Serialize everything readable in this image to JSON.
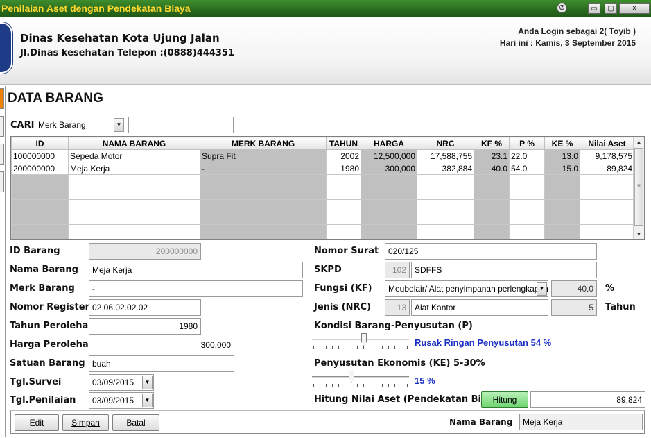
{
  "window": {
    "title": "Penilaian Aset dengan Pendekatan Biaya",
    "minimize_glyph": "▭",
    "maximize_glyph": "▢",
    "close_glyph": "X",
    "system_glyph": "⊘"
  },
  "header": {
    "org_name": "Dinas Kesehatan Kota Ujung Jalan",
    "address": "Jl.Dinas kesehatan Telepon :(0888)444351",
    "login_text": "Anda Login sebagai 2( Toyib )",
    "date_text": "Hari ini : Kamis, 3 September 2015"
  },
  "page_title": "DATA BARANG",
  "search": {
    "label": "CARI",
    "field_select": "Merk Barang",
    "query": ""
  },
  "grid": {
    "columns": [
      "ID",
      "NAMA BARANG",
      "MERK BARANG",
      "TAHUN",
      "HARGA",
      "NRC",
      "KF %",
      "P %",
      "KE %",
      "Nilai Aset"
    ],
    "rows": [
      [
        "100000000",
        "Sepeda Motor",
        "Supra Fit",
        "2002",
        "12,500,000",
        "17,588,755",
        "23.1",
        "22.0",
        "13.0",
        "9,178,575"
      ],
      [
        "200000000",
        "Meja Kerja",
        "-",
        "1980",
        "300,000",
        "382,884",
        "40.0",
        "54.0",
        "15.0",
        "89,824"
      ]
    ]
  },
  "form_left": {
    "id_label": "ID Barang",
    "id_value": "200000000",
    "nama_label": "Nama Barang",
    "nama_value": "Meja Kerja",
    "merk_label": "Merk Barang",
    "merk_value": "-",
    "register_label": "Nomor Register",
    "register_value": "02.06.02.02.02",
    "tahun_label": "Tahun Perolehan",
    "tahun_value": "1980",
    "harga_label": "Harga Perolehan",
    "harga_value": "300,000",
    "satuan_label": "Satuan Barang",
    "satuan_value": "buah",
    "survei_label": "Tgl.Survei",
    "survei_value": "03/09/2015",
    "penilaian_label": "Tgl.Penilaian",
    "penilaian_value": "03/09/2015"
  },
  "form_right": {
    "surat_label": "Nomor Surat",
    "surat_value": "020/125",
    "skpd_label": "SKPD",
    "skpd_code": "102",
    "skpd_name": "SDFFS",
    "fungsi_label": "Fungsi (KF)",
    "fungsi_value": "Meubelair/ Alat penyimpanan perlengkapan",
    "fungsi_pct": "40.0",
    "pct_unit": "%",
    "jenis_label": "Jenis (NRC)",
    "jenis_code": "13",
    "jenis_name": "Alat Kantor",
    "jenis_years": "5",
    "years_unit": "Tahun",
    "kondisi_label": "Kondisi Barang-Penyusutan (P)",
    "kondisi_text": "Rusak Ringan Penyusutan 54 %",
    "kondisi_level": 0.54,
    "ekonomis_label": "Penyusutan Ekonomis (KE) 5-30%",
    "ekonomis_text": "15 %",
    "ekonomis_level": 0.4,
    "hitung_label": "Hitung Nilai Aset (Pendekatan Biaya)",
    "hitung_button": "Hitung",
    "nilai_aset": "89,824"
  },
  "bottom": {
    "edit_button": "Edit",
    "simpan_button": "Simpan",
    "batal_button": "Batal",
    "nama_label": "Nama Barang",
    "nama_value": "Meja Kerja"
  }
}
